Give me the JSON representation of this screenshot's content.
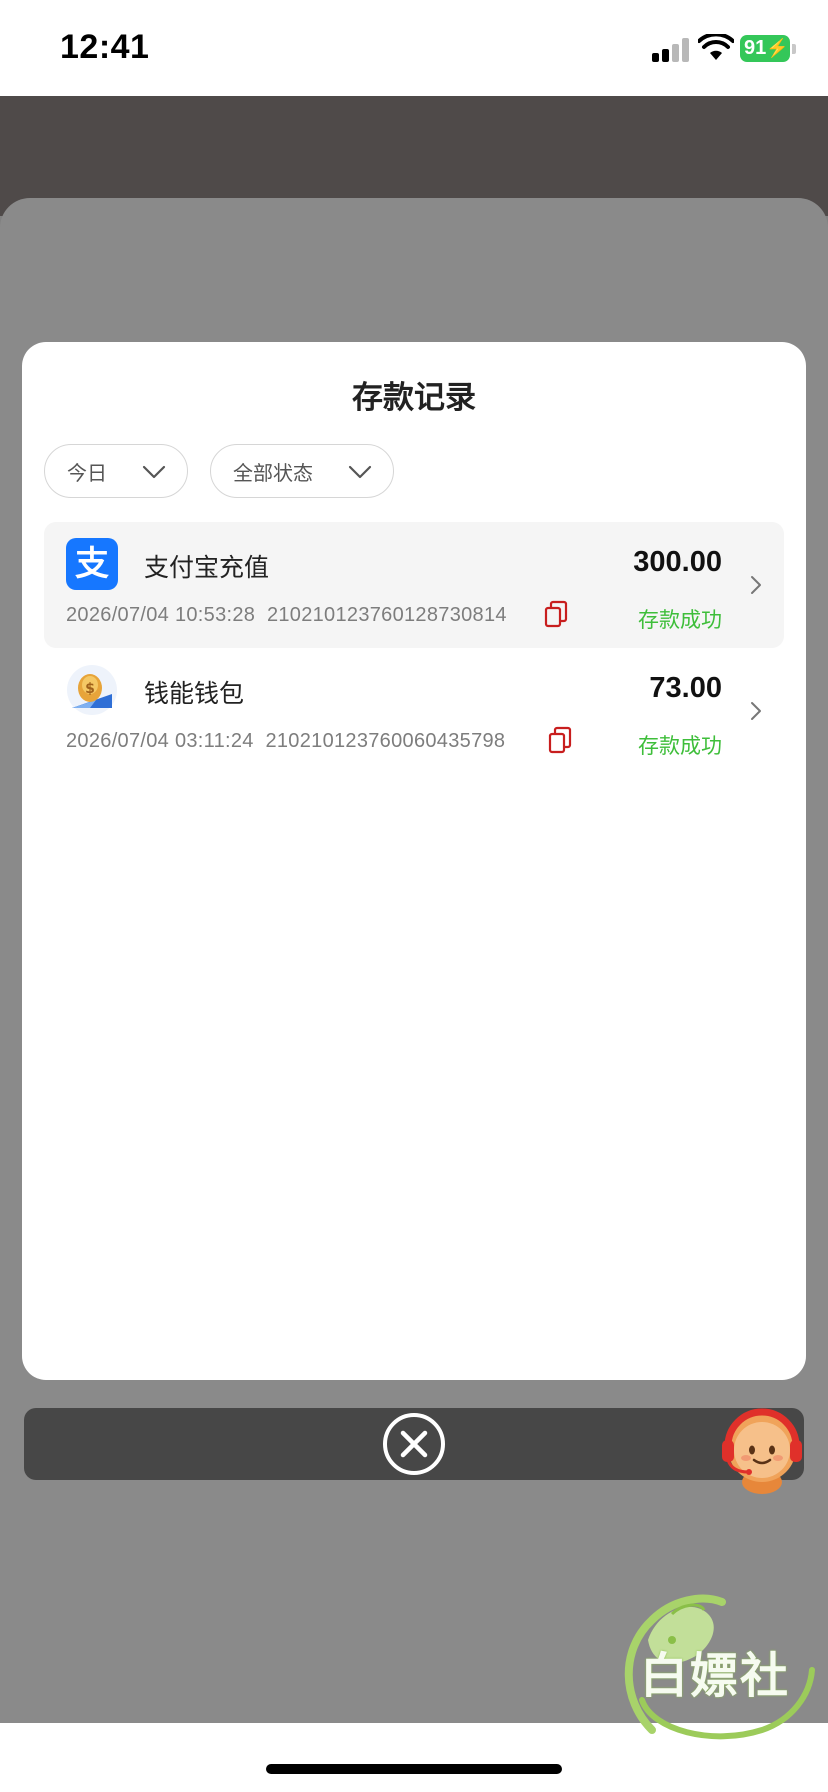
{
  "status_bar": {
    "time": "12:41",
    "battery": "91"
  },
  "modal": {
    "title": "存款记录",
    "filters": [
      {
        "label": "今日"
      },
      {
        "label": "全部状态"
      }
    ],
    "records": [
      {
        "name": "支付宝充值",
        "amount": "300.00",
        "datetime": "2026/07/04 10:53:28",
        "order_id": "210210123760128730814",
        "status": "存款成功",
        "icon": "alipay-icon",
        "icon_glyph": "支"
      },
      {
        "name": "钱能钱包",
        "amount": "73.00",
        "datetime": "2026/07/04 03:11:24",
        "order_id": "210210123760060435798",
        "status": "存款成功",
        "icon": "wallet-icon"
      }
    ]
  },
  "watermark": {
    "text": "白嫖社"
  },
  "colors": {
    "success": "#3ebe3a",
    "alipay": "#1677ff",
    "copy_icon": "#c81e1e",
    "battery": "#34c759",
    "overlay": "#818181"
  }
}
